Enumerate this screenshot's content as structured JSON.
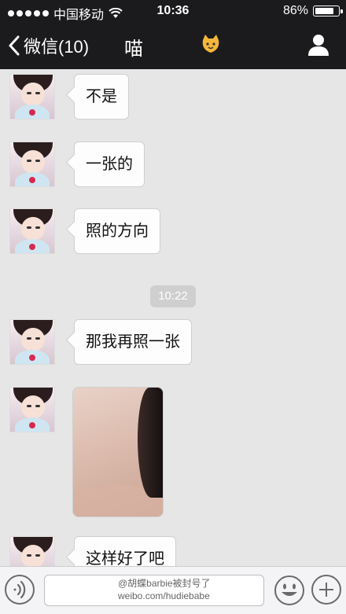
{
  "status_bar": {
    "carrier": "中国移动",
    "time": "10:36",
    "battery_text": "86%",
    "battery_level": 0.86
  },
  "nav": {
    "back_label": "微信(10)",
    "title": "喵",
    "right_icon": "person-icon",
    "emoji_icon": "cat-face-icon"
  },
  "messages": [
    {
      "type": "text",
      "text": "不是"
    },
    {
      "type": "text",
      "text": "一张的"
    },
    {
      "type": "text",
      "text": "照的方向"
    },
    {
      "type": "timestamp",
      "text": "10:22"
    },
    {
      "type": "text",
      "text": "那我再照一张"
    },
    {
      "type": "image",
      "icon": "selfie-photo"
    },
    {
      "type": "text",
      "text": "这样好了吧"
    }
  ],
  "input_bar": {
    "voice_icon": "voice-icon",
    "emoji_icon": "smiley-icon",
    "plus_icon": "plus-icon"
  },
  "watermark": {
    "line1": "@胡蝶barbie被封号了",
    "line2": "weibo.com/hudiebabe"
  }
}
